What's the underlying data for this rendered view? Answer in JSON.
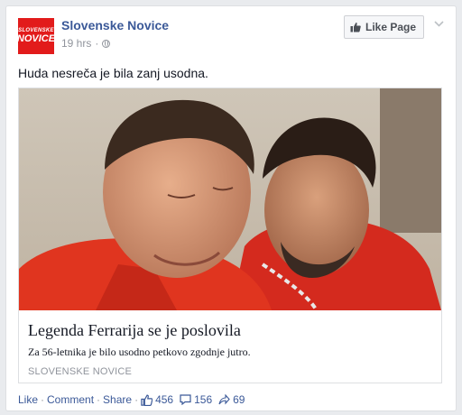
{
  "page": {
    "name": "Slovenske Novice",
    "logo_line1": "SLOVENSKE",
    "logo_line2": "NOVICE",
    "timestamp": "19 hrs",
    "privacy_icon": "globe-icon"
  },
  "like_page_label": "Like Page",
  "post_text": "Huda nesreča je bila zanj usodna.",
  "attachment": {
    "title": "Legenda Ferrarija se je poslovila",
    "description": "Za 56-letnika je bilo usodno petkovo zgodnje jutro.",
    "source": "SLOVENSKE NOVICE"
  },
  "actions": {
    "like": "Like",
    "comment": "Comment",
    "share": "Share",
    "likes_count": "456",
    "comments_count": "156",
    "shares_count": "69"
  },
  "colors": {
    "link_blue": "#3b5998",
    "brand_red": "#e21b1b",
    "meta_gray": "#90949c"
  }
}
